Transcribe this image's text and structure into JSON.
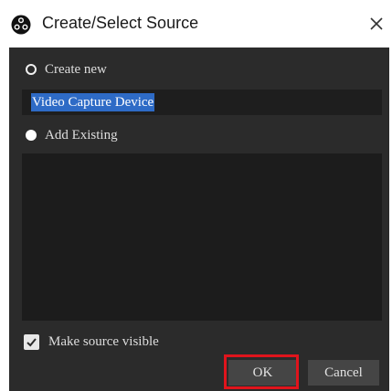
{
  "window": {
    "title": "Create/Select Source",
    "icon": "obs-logo-icon",
    "close_icon": "close-icon"
  },
  "options": {
    "create_new_label": "Create new",
    "create_new_selected": false,
    "source_name_value": "Video Capture Device",
    "add_existing_label": "Add Existing",
    "add_existing_selected": true,
    "existing_sources": []
  },
  "visibility": {
    "label": "Make source visible",
    "checked": true
  },
  "buttons": {
    "ok_label": "OK",
    "cancel_label": "Cancel"
  },
  "colors": {
    "panel_background": "#2b2b2b",
    "field_background": "#1e1e1e",
    "selection_highlight": "#2e6bc6",
    "annotation_box": "#e0141c"
  }
}
